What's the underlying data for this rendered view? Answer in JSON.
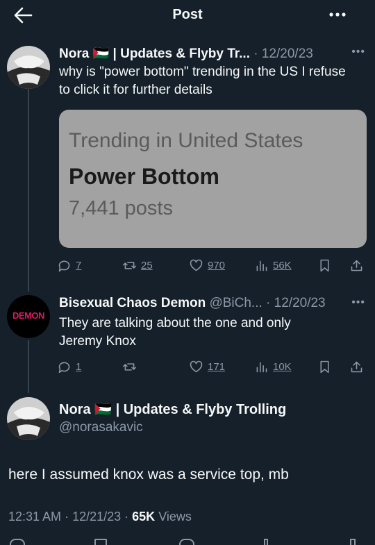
{
  "header": {
    "title": "Post"
  },
  "thread": [
    {
      "name": "Nora 🇵🇸 | Updates & Flyby Tr...",
      "sep": " · ",
      "date": "12/20/23",
      "text": "why is \"power bottom\" trending in the US I refuse to click it for further details",
      "media": {
        "line1": "Trending in United States",
        "line2": "Power Bottom",
        "line3": "7,441 posts"
      },
      "stats": {
        "replies": "7",
        "reposts": "25",
        "likes": "970",
        "views": "56K"
      }
    },
    {
      "name": "Bisexual Chaos Demon",
      "handle": "@BiCh...",
      "sep": " · ",
      "date": "12/20/23",
      "avatar_text": "DEMON",
      "text": "They are talking about the one and only Jeremy Knox",
      "stats": {
        "replies": "1",
        "reposts": "",
        "likes": "171",
        "views": "10K"
      }
    }
  ],
  "main_post": {
    "name": "Nora 🇵🇸 | Updates & Flyby Trolling",
    "handle": "@norasakavic",
    "text": "here I assumed knox was a service top, mb",
    "time": "12:31 AM",
    "sep": " · ",
    "date": "12/21/23",
    "sep2": " · ",
    "views_count": "65K",
    "views_label": "Views"
  },
  "colors": {
    "background": "#15202b",
    "text": "#f7f9f9",
    "muted": "#8b98a5",
    "avatar_text": "#d81b60"
  },
  "icons": [
    "back-arrow-icon",
    "more-icon",
    "reply-icon",
    "repost-icon",
    "like-icon",
    "views-icon",
    "bookmark-icon",
    "share-icon"
  ]
}
